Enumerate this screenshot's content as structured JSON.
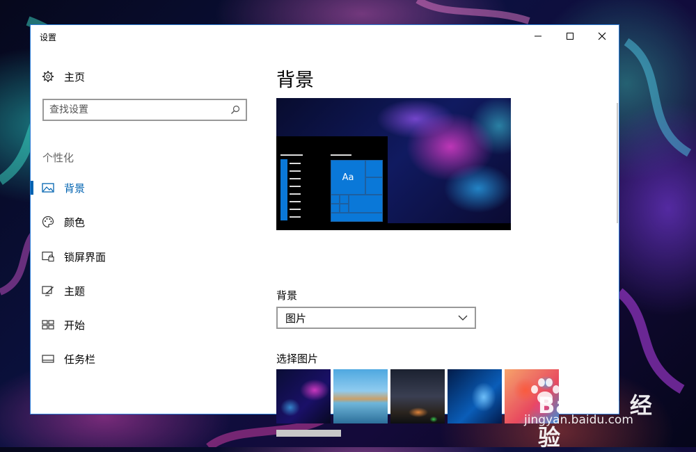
{
  "window": {
    "title": "设置",
    "accent": "#0063b1"
  },
  "sidebar": {
    "home_label": "主页",
    "search_placeholder": "查找设置",
    "section_label": "个性化",
    "items": [
      {
        "label": "背景",
        "icon": "picture-icon",
        "active": true
      },
      {
        "label": "颜色",
        "icon": "palette-icon",
        "active": false
      },
      {
        "label": "锁屏界面",
        "icon": "lock-screen-icon",
        "active": false
      },
      {
        "label": "主题",
        "icon": "theme-brush-icon",
        "active": false
      },
      {
        "label": "开始",
        "icon": "start-grid-icon",
        "active": false
      },
      {
        "label": "任务栏",
        "icon": "taskbar-icon",
        "active": false
      }
    ]
  },
  "main": {
    "page_title": "背景",
    "preview_tile_text": "Aa",
    "background_label": "背景",
    "background_value": "图片",
    "choose_picture_label": "选择图片",
    "pictures": [
      "abstract-swirl",
      "beach-rock",
      "night-sky-tent",
      "windows-10-light",
      "colorful-smoke"
    ]
  },
  "watermark": {
    "brand": "Bai du 经验",
    "url": "jingyan.baidu.com"
  }
}
